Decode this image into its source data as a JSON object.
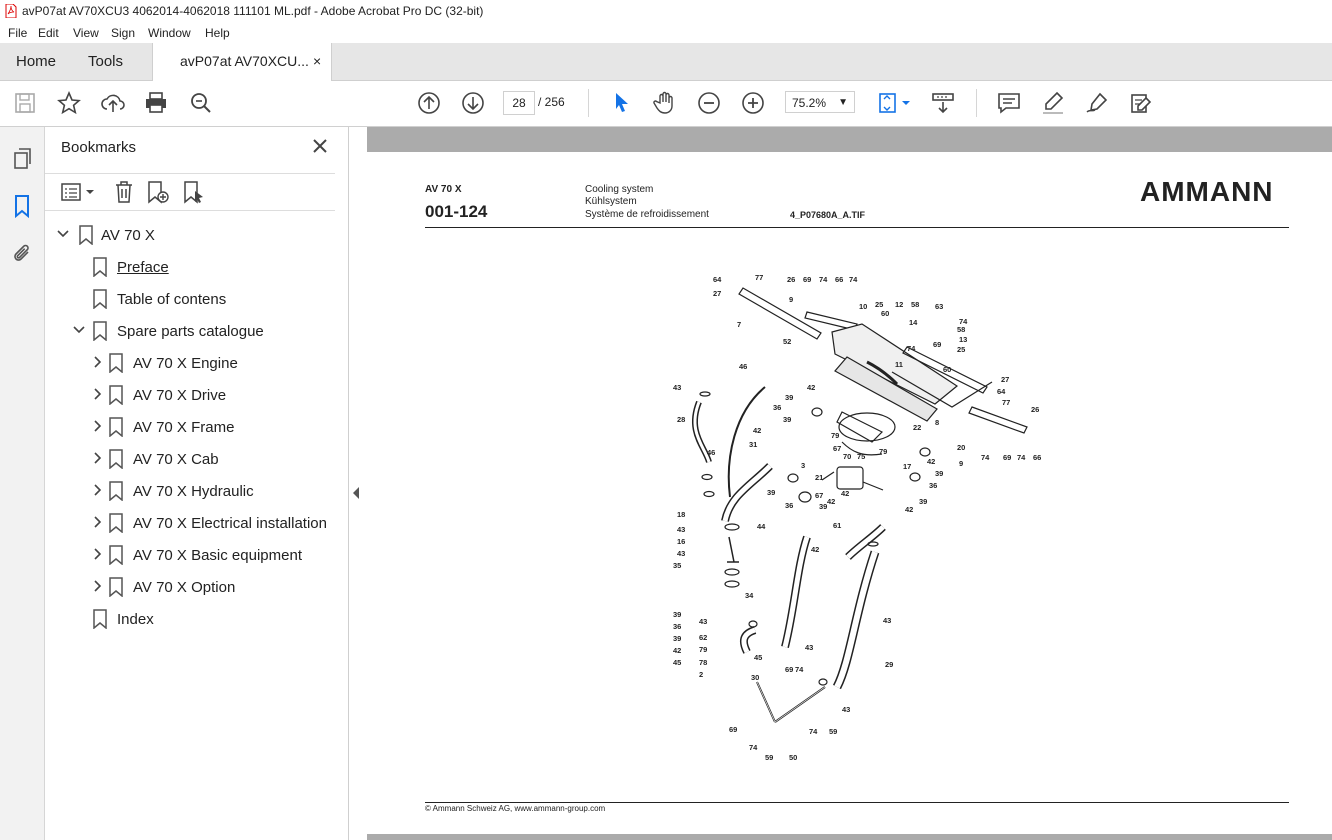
{
  "window": {
    "title": "avP07at AV70XCU3 4062014-4062018 111101 ML.pdf - Adobe Acrobat Pro DC (32-bit)"
  },
  "menu": [
    "File",
    "Edit",
    "View",
    "Sign",
    "Window",
    "Help"
  ],
  "tabs": {
    "home": "Home",
    "tools": "Tools",
    "document": "avP07at AV70XCU...",
    "close_glyph": "×"
  },
  "toolbar": {
    "page_current": "28",
    "page_total": "/  256",
    "zoom": "75.2%"
  },
  "bookmarks": {
    "title": "Bookmarks",
    "items": [
      {
        "label": "AV 70 X"
      },
      {
        "label": "Preface"
      },
      {
        "label": "Table of contens"
      },
      {
        "label": "Spare parts catalogue"
      },
      {
        "label": "AV 70 X Engine"
      },
      {
        "label": "AV 70 X Drive"
      },
      {
        "label": "AV 70 X Frame"
      },
      {
        "label": "AV 70 X Cab"
      },
      {
        "label": "AV 70 X Hydraulic"
      },
      {
        "label": "AV 70 X Electrical installation"
      },
      {
        "label": "AV 70 X Basic equipment"
      },
      {
        "label": "AV 70 X Option"
      },
      {
        "label": "Index"
      }
    ]
  },
  "document_page": {
    "model": "AV 70 X",
    "code": "001-124",
    "section_en": "Cooling system",
    "section_de": "Kühlsystem",
    "section_fr": "Système de refroidissement",
    "image_file": "4_P07680A_A.TIF",
    "brand": "AMMANN",
    "footer": "© Ammann Schweiz AG, www.ammann-group.com",
    "part_numbers": [
      "64",
      "77",
      "27",
      "7",
      "26",
      "69",
      "74",
      "66",
      "74",
      "9",
      "10",
      "25",
      "12",
      "58",
      "63",
      "14",
      "74",
      "58",
      "13",
      "25",
      "60",
      "69",
      "74",
      "11",
      "60",
      "52",
      "46",
      "43",
      "42",
      "39",
      "27",
      "64",
      "77",
      "26",
      "28",
      "36",
      "39",
      "42",
      "31",
      "46",
      "79",
      "67",
      "70",
      "75",
      "79",
      "22",
      "20",
      "9",
      "74",
      "69",
      "74",
      "66",
      "8",
      "42",
      "39",
      "36",
      "39",
      "42",
      "17",
      "3",
      "21",
      "67",
      "61",
      "42",
      "39",
      "36",
      "39",
      "42",
      "18",
      "43",
      "16",
      "43",
      "35",
      "44",
      "42",
      "39",
      "36",
      "39",
      "42",
      "45",
      "30",
      "43",
      "29",
      "43",
      "34",
      "43",
      "62",
      "79",
      "78",
      "2",
      "45",
      "69",
      "74",
      "43",
      "69",
      "74",
      "59",
      "50",
      "74",
      "59"
    ]
  }
}
